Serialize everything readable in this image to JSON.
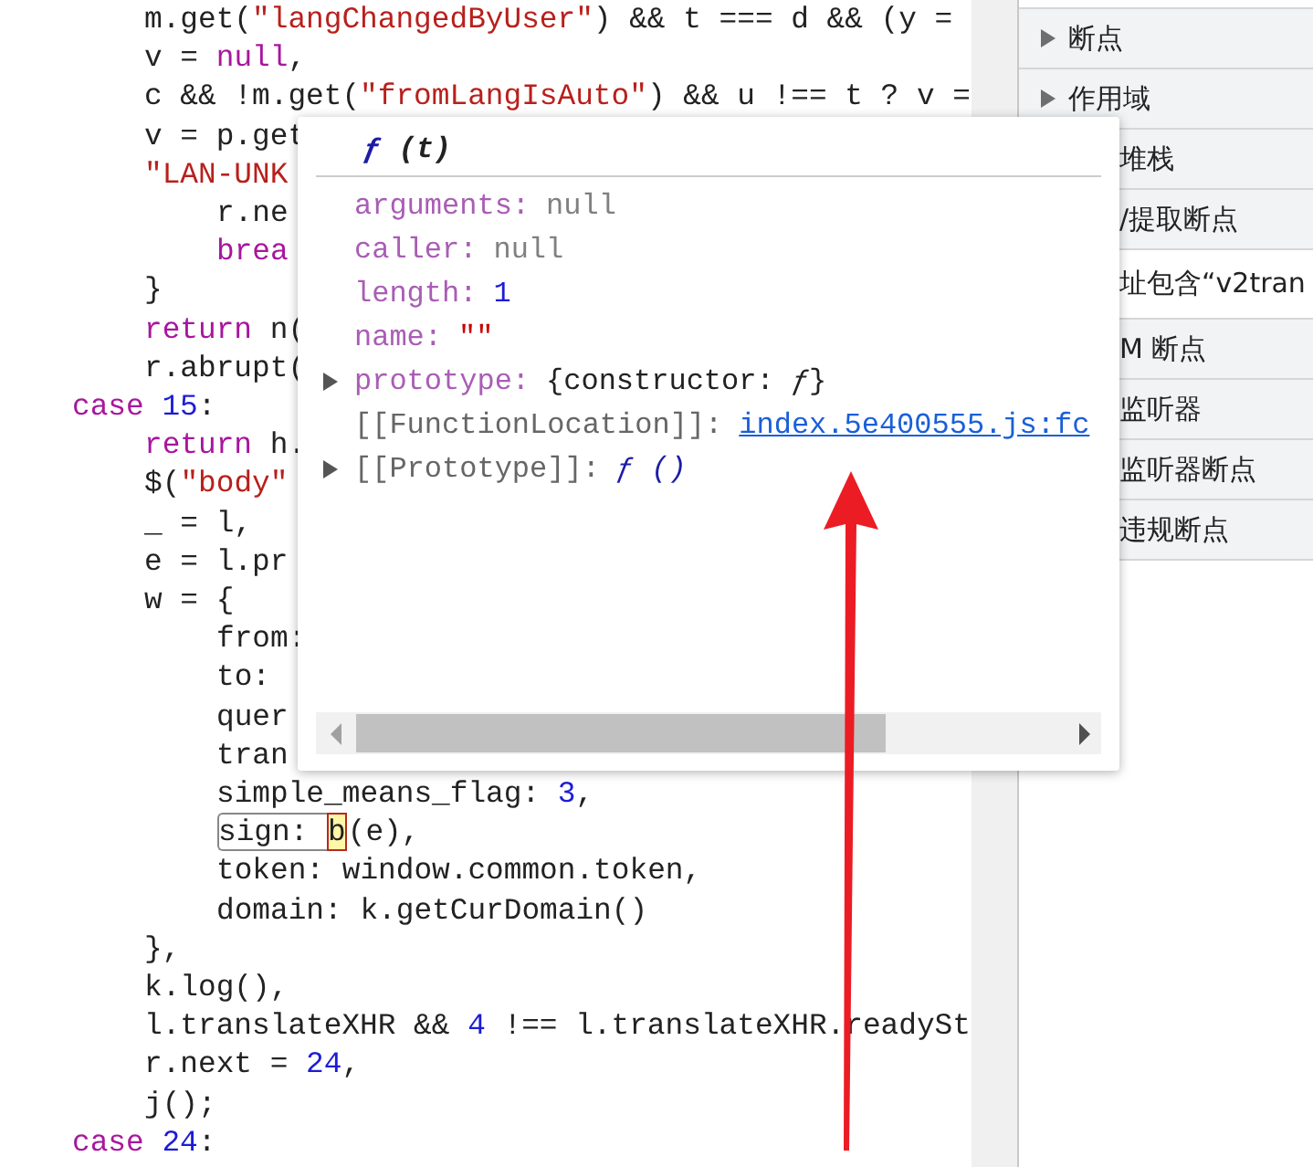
{
  "code_lines": [
    {
      "children": [
        {
          "tokens": [
            {
              "text": "m.get(",
              "kind": "plain"
            },
            {
              "text": "\"langChangedByUser\"",
              "kind": "str"
            },
            {
              "text": ") && t === d && (y =",
              "kind": "plain"
            }
          ]
        },
        {
          "tokens": [
            {
              "text": "v = ",
              "kind": "plain"
            },
            {
              "text": "null",
              "kind": "kw"
            },
            {
              "text": ",",
              "kind": "plain"
            }
          ]
        },
        {
          "tokens": [
            {
              "text": "c && !m.get(",
              "kind": "plain"
            },
            {
              "text": "\"fromLangIsAuto\"",
              "kind": "str"
            },
            {
              "text": ") && u !== t ? v =",
              "kind": "plain"
            }
          ]
        },
        {
          "tokens": [
            {
              "text": "v = p.get",
              "kind": "plain"
            }
          ]
        },
        {
          "tokens": [
            {
              "text": "\"LAN-UNK",
              "kind": "str"
            }
          ],
          "children": [
            {
              "tokens": [
                {
                  "text": "r.ne",
                  "kind": "plain"
                }
              ]
            },
            {
              "tokens": [
                {
                  "text": "brea",
                  "kind": "kw"
                }
              ]
            }
          ]
        },
        {
          "tokens": [
            {
              "text": "}",
              "kind": "plain"
            }
          ]
        },
        {
          "tokens": [
            {
              "text": "return",
              "kind": "kw"
            },
            {
              "text": " n(",
              "kind": "plain"
            }
          ]
        },
        {
          "tokens": [
            {
              "text": "r.abrupt(",
              "kind": "plain"
            }
          ]
        }
      ]
    },
    {
      "tokens": [
        {
          "text": "case",
          "kind": "kw"
        },
        {
          "text": " 15",
          "kind": "num"
        },
        {
          "text": ":",
          "kind": "plain"
        }
      ],
      "children": [
        {
          "tokens": [
            {
              "text": "return",
              "kind": "kw"
            },
            {
              "text": " h.",
              "kind": "plain"
            }
          ]
        },
        {
          "tokens": [
            {
              "text": "$(",
              "kind": "plain"
            },
            {
              "text": "\"body\"",
              "kind": "str"
            }
          ]
        },
        {
          "tokens": [
            {
              "text": "_ = l,",
              "kind": "plain"
            }
          ]
        },
        {
          "tokens": [
            {
              "text": "e = l.pr",
              "kind": "plain"
            }
          ]
        },
        {
          "tokens": [
            {
              "text": "w = {",
              "kind": "plain"
            }
          ],
          "children": [
            {
              "tokens": [
                {
                  "text": "from:",
                  "kind": "plain"
                }
              ]
            },
            {
              "tokens": [
                {
                  "text": "to:",
                  "kind": "plain"
                }
              ]
            },
            {
              "tokens": [
                {
                  "text": "quer",
                  "kind": "plain"
                }
              ]
            },
            {
              "tokens": [
                {
                  "text": "tran",
                  "kind": "plain"
                }
              ]
            },
            {
              "tokens": [
                {
                  "text": "simple_means_flag: ",
                  "kind": "plain"
                },
                {
                  "text": "3",
                  "kind": "num"
                },
                {
                  "text": ",",
                  "kind": "plain"
                }
              ]
            },
            {
              "tokens": [
                {
                  "text": "sign: ",
                  "kind": "boxed"
                },
                {
                  "text": "b",
                  "kind": "cursor"
                },
                {
                  "text": "(e),",
                  "kind": "plain"
                }
              ]
            },
            {
              "tokens": [
                {
                  "text": "token: window.common.token,",
                  "kind": "plain"
                }
              ]
            },
            {
              "tokens": [
                {
                  "text": "domain: k.getCurDomain()",
                  "kind": "plain"
                }
              ]
            }
          ]
        },
        {
          "tokens": [
            {
              "text": "},",
              "kind": "plain"
            }
          ]
        },
        {
          "tokens": [
            {
              "text": "k.log(),",
              "kind": "plain"
            }
          ]
        },
        {
          "tokens": [
            {
              "text": "l.translateXHR && ",
              "kind": "plain"
            },
            {
              "text": "4",
              "kind": "num"
            },
            {
              "text": " !== l.translateXHR.readySt",
              "kind": "plain"
            }
          ]
        },
        {
          "tokens": [
            {
              "text": "r.next = ",
              "kind": "plain"
            },
            {
              "text": "24",
              "kind": "num"
            },
            {
              "text": ",",
              "kind": "plain"
            }
          ]
        },
        {
          "tokens": [
            {
              "text": "j();",
              "kind": "plain"
            }
          ]
        }
      ]
    },
    {
      "tokens": [
        {
          "text": "case",
          "kind": "kw"
        },
        {
          "text": " 24",
          "kind": "num"
        },
        {
          "text": ":",
          "kind": "plain"
        }
      ]
    }
  ],
  "sidebar": {
    "items": [
      {
        "label": "断点",
        "kind": "section",
        "covered": false
      },
      {
        "label": "作用域",
        "kind": "section",
        "covered": false
      },
      {
        "label": "堆栈",
        "kind": "section",
        "covered": true
      },
      {
        "label": "/提取断点",
        "kind": "section",
        "covered": true
      },
      {
        "label": "址包含“v2tran",
        "kind": "entry",
        "covered": true
      },
      {
        "label": "M 断点",
        "kind": "section",
        "covered": true
      },
      {
        "label": "监听器",
        "kind": "section",
        "covered": true
      },
      {
        "label": "监听器断点",
        "kind": "section",
        "covered": true
      },
      {
        "label": "违规断点",
        "kind": "section",
        "covered": true
      }
    ]
  },
  "popover": {
    "mark": "ƒ",
    "params": "(t)",
    "properties": [
      {
        "key": "arguments:",
        "internal": false,
        "value": "null",
        "kind": "null",
        "expandable": false
      },
      {
        "key": "caller:",
        "internal": false,
        "value": "null",
        "kind": "null",
        "expandable": false
      },
      {
        "key": "length:",
        "internal": false,
        "value": "1",
        "kind": "num",
        "expandable": false
      },
      {
        "key": "name:",
        "internal": false,
        "value": "\"\"",
        "kind": "str",
        "expandable": false
      },
      {
        "key": "prototype:",
        "internal": false,
        "value": "{constructor: *ƒ*}",
        "kind": "obj",
        "expandable": true
      },
      {
        "key": "[[FunctionLocation]]:",
        "internal": true,
        "value": "index.5e400555.js:fc",
        "kind": "link",
        "expandable": false
      },
      {
        "key": "[[Prototype]]:",
        "internal": true,
        "value": "ƒ ()",
        "kind": "func",
        "expandable": true
      }
    ]
  }
}
